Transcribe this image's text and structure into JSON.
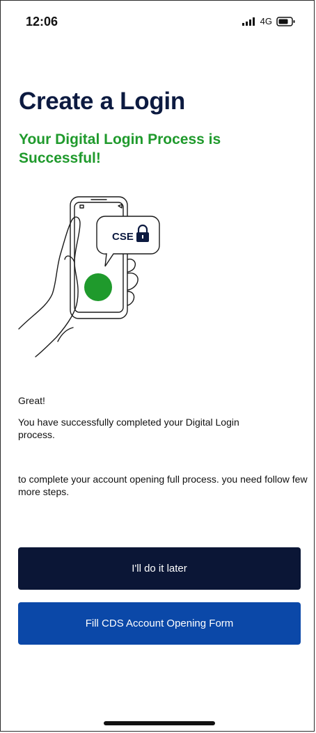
{
  "status_bar": {
    "time": "12:06",
    "network": "4G"
  },
  "page": {
    "title": "Create a Login",
    "subtitle": "Your Digital Login Process is Successful!"
  },
  "illustration": {
    "badge_text": "CSE",
    "accent_color": "#1f9a2c",
    "icons": [
      "hand-holding-phone-icon",
      "lock-icon",
      "status-dot-icon"
    ]
  },
  "messages": {
    "greeting": "Great!",
    "success": "You have successfully completed your Digital Login process.",
    "next_steps": "to complete your account opening full process. you need follow few more steps."
  },
  "actions": {
    "later_label": "I'll do it later",
    "cds_label": "Fill CDS Account Opening Form"
  },
  "colors": {
    "title": "#0c1a40",
    "subtitle": "#1f9a2c",
    "later_button": "#0b1636",
    "cds_button": "#0b48a8"
  }
}
